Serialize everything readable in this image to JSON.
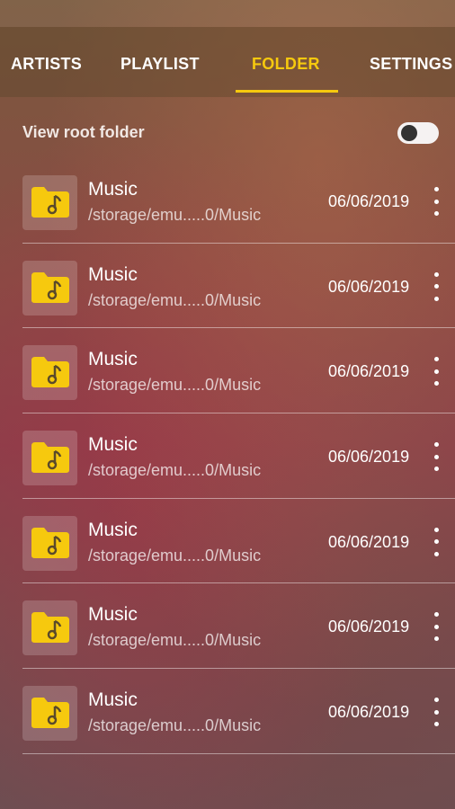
{
  "tabs": [
    {
      "label": "ARTISTS",
      "active": false
    },
    {
      "label": "PLAYLIST",
      "active": false
    },
    {
      "label": "FOLDER",
      "active": true
    },
    {
      "label": "SETTINGS",
      "active": false
    }
  ],
  "root": {
    "label": "View root folder",
    "enabled": false
  },
  "folders": [
    {
      "name": "Music",
      "path": "/storage/emu.....0/Music",
      "date": "06/06/2019"
    },
    {
      "name": "Music",
      "path": "/storage/emu.....0/Music",
      "date": "06/06/2019"
    },
    {
      "name": "Music",
      "path": "/storage/emu.....0/Music",
      "date": "06/06/2019"
    },
    {
      "name": "Music",
      "path": "/storage/emu.....0/Music",
      "date": "06/06/2019"
    },
    {
      "name": "Music",
      "path": "/storage/emu.....0/Music",
      "date": "06/06/2019"
    },
    {
      "name": "Music",
      "path": "/storage/emu.....0/Music",
      "date": "06/06/2019"
    },
    {
      "name": "Music",
      "path": "/storage/emu.....0/Music",
      "date": "06/06/2019"
    }
  ],
  "icons": {
    "folder": "music-folder-icon",
    "menu": "more-vert-icon"
  },
  "colors": {
    "accent": "#f6c90e",
    "folder_icon": "#f6c90e",
    "folder_note": "#5a4a2a"
  }
}
